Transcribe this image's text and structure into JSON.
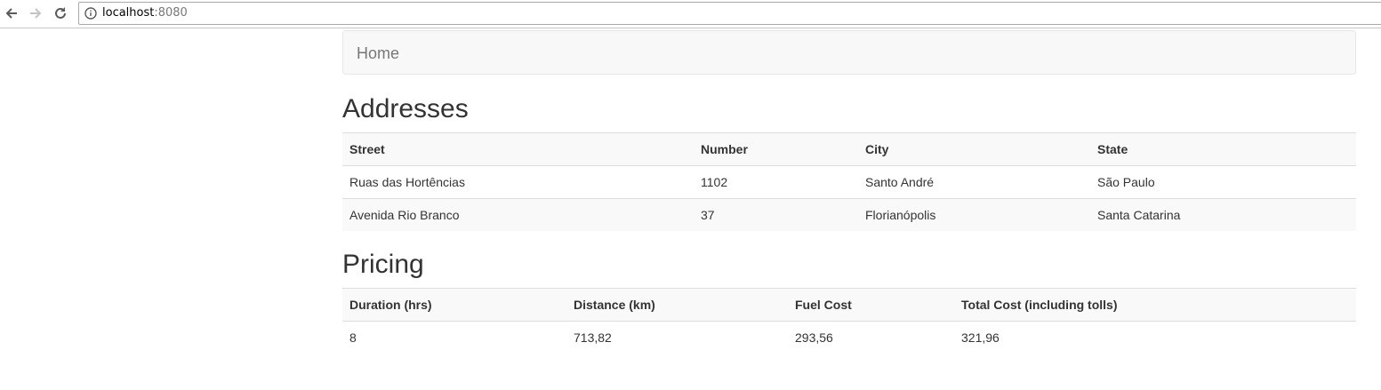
{
  "browser": {
    "url_host": "localhost",
    "url_port": ":8080"
  },
  "navbar": {
    "brand": "Home"
  },
  "addresses": {
    "heading": "Addresses",
    "columns": [
      "Street",
      "Number",
      "City",
      "State"
    ],
    "rows": [
      [
        "Ruas das Hortências",
        "1102",
        "Santo André",
        "São Paulo"
      ],
      [
        "Avenida Rio Branco",
        "37",
        "Florianópolis",
        "Santa Catarina"
      ]
    ]
  },
  "pricing": {
    "heading": "Pricing",
    "columns": [
      "Duration (hrs)",
      "Distance (km)",
      "Fuel Cost",
      "Total Cost (including tolls)"
    ],
    "rows": [
      [
        "8",
        "713,82",
        "293,56",
        "321,96"
      ]
    ]
  }
}
